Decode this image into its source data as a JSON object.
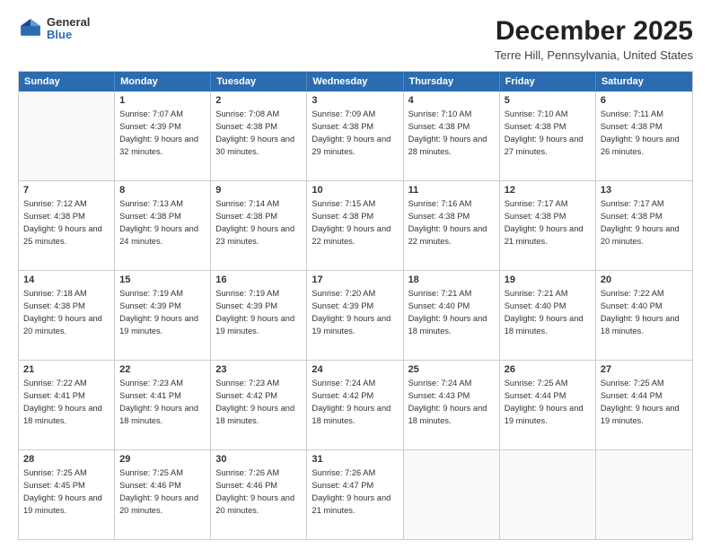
{
  "header": {
    "logo_general": "General",
    "logo_blue": "Blue",
    "title": "December 2025",
    "subtitle": "Terre Hill, Pennsylvania, United States"
  },
  "days_of_week": [
    "Sunday",
    "Monday",
    "Tuesday",
    "Wednesday",
    "Thursday",
    "Friday",
    "Saturday"
  ],
  "weeks": [
    [
      {
        "day": "",
        "empty": true
      },
      {
        "day": "1",
        "sunrise": "Sunrise: 7:07 AM",
        "sunset": "Sunset: 4:39 PM",
        "daylight": "Daylight: 9 hours and 32 minutes."
      },
      {
        "day": "2",
        "sunrise": "Sunrise: 7:08 AM",
        "sunset": "Sunset: 4:38 PM",
        "daylight": "Daylight: 9 hours and 30 minutes."
      },
      {
        "day": "3",
        "sunrise": "Sunrise: 7:09 AM",
        "sunset": "Sunset: 4:38 PM",
        "daylight": "Daylight: 9 hours and 29 minutes."
      },
      {
        "day": "4",
        "sunrise": "Sunrise: 7:10 AM",
        "sunset": "Sunset: 4:38 PM",
        "daylight": "Daylight: 9 hours and 28 minutes."
      },
      {
        "day": "5",
        "sunrise": "Sunrise: 7:10 AM",
        "sunset": "Sunset: 4:38 PM",
        "daylight": "Daylight: 9 hours and 27 minutes."
      },
      {
        "day": "6",
        "sunrise": "Sunrise: 7:11 AM",
        "sunset": "Sunset: 4:38 PM",
        "daylight": "Daylight: 9 hours and 26 minutes."
      }
    ],
    [
      {
        "day": "7",
        "sunrise": "Sunrise: 7:12 AM",
        "sunset": "Sunset: 4:38 PM",
        "daylight": "Daylight: 9 hours and 25 minutes."
      },
      {
        "day": "8",
        "sunrise": "Sunrise: 7:13 AM",
        "sunset": "Sunset: 4:38 PM",
        "daylight": "Daylight: 9 hours and 24 minutes."
      },
      {
        "day": "9",
        "sunrise": "Sunrise: 7:14 AM",
        "sunset": "Sunset: 4:38 PM",
        "daylight": "Daylight: 9 hours and 23 minutes."
      },
      {
        "day": "10",
        "sunrise": "Sunrise: 7:15 AM",
        "sunset": "Sunset: 4:38 PM",
        "daylight": "Daylight: 9 hours and 22 minutes."
      },
      {
        "day": "11",
        "sunrise": "Sunrise: 7:16 AM",
        "sunset": "Sunset: 4:38 PM",
        "daylight": "Daylight: 9 hours and 22 minutes."
      },
      {
        "day": "12",
        "sunrise": "Sunrise: 7:17 AM",
        "sunset": "Sunset: 4:38 PM",
        "daylight": "Daylight: 9 hours and 21 minutes."
      },
      {
        "day": "13",
        "sunrise": "Sunrise: 7:17 AM",
        "sunset": "Sunset: 4:38 PM",
        "daylight": "Daylight: 9 hours and 20 minutes."
      }
    ],
    [
      {
        "day": "14",
        "sunrise": "Sunrise: 7:18 AM",
        "sunset": "Sunset: 4:38 PM",
        "daylight": "Daylight: 9 hours and 20 minutes."
      },
      {
        "day": "15",
        "sunrise": "Sunrise: 7:19 AM",
        "sunset": "Sunset: 4:39 PM",
        "daylight": "Daylight: 9 hours and 19 minutes."
      },
      {
        "day": "16",
        "sunrise": "Sunrise: 7:19 AM",
        "sunset": "Sunset: 4:39 PM",
        "daylight": "Daylight: 9 hours and 19 minutes."
      },
      {
        "day": "17",
        "sunrise": "Sunrise: 7:20 AM",
        "sunset": "Sunset: 4:39 PM",
        "daylight": "Daylight: 9 hours and 19 minutes."
      },
      {
        "day": "18",
        "sunrise": "Sunrise: 7:21 AM",
        "sunset": "Sunset: 4:40 PM",
        "daylight": "Daylight: 9 hours and 18 minutes."
      },
      {
        "day": "19",
        "sunrise": "Sunrise: 7:21 AM",
        "sunset": "Sunset: 4:40 PM",
        "daylight": "Daylight: 9 hours and 18 minutes."
      },
      {
        "day": "20",
        "sunrise": "Sunrise: 7:22 AM",
        "sunset": "Sunset: 4:40 PM",
        "daylight": "Daylight: 9 hours and 18 minutes."
      }
    ],
    [
      {
        "day": "21",
        "sunrise": "Sunrise: 7:22 AM",
        "sunset": "Sunset: 4:41 PM",
        "daylight": "Daylight: 9 hours and 18 minutes."
      },
      {
        "day": "22",
        "sunrise": "Sunrise: 7:23 AM",
        "sunset": "Sunset: 4:41 PM",
        "daylight": "Daylight: 9 hours and 18 minutes."
      },
      {
        "day": "23",
        "sunrise": "Sunrise: 7:23 AM",
        "sunset": "Sunset: 4:42 PM",
        "daylight": "Daylight: 9 hours and 18 minutes."
      },
      {
        "day": "24",
        "sunrise": "Sunrise: 7:24 AM",
        "sunset": "Sunset: 4:42 PM",
        "daylight": "Daylight: 9 hours and 18 minutes."
      },
      {
        "day": "25",
        "sunrise": "Sunrise: 7:24 AM",
        "sunset": "Sunset: 4:43 PM",
        "daylight": "Daylight: 9 hours and 18 minutes."
      },
      {
        "day": "26",
        "sunrise": "Sunrise: 7:25 AM",
        "sunset": "Sunset: 4:44 PM",
        "daylight": "Daylight: 9 hours and 19 minutes."
      },
      {
        "day": "27",
        "sunrise": "Sunrise: 7:25 AM",
        "sunset": "Sunset: 4:44 PM",
        "daylight": "Daylight: 9 hours and 19 minutes."
      }
    ],
    [
      {
        "day": "28",
        "sunrise": "Sunrise: 7:25 AM",
        "sunset": "Sunset: 4:45 PM",
        "daylight": "Daylight: 9 hours and 19 minutes."
      },
      {
        "day": "29",
        "sunrise": "Sunrise: 7:25 AM",
        "sunset": "Sunset: 4:46 PM",
        "daylight": "Daylight: 9 hours and 20 minutes."
      },
      {
        "day": "30",
        "sunrise": "Sunrise: 7:26 AM",
        "sunset": "Sunset: 4:46 PM",
        "daylight": "Daylight: 9 hours and 20 minutes."
      },
      {
        "day": "31",
        "sunrise": "Sunrise: 7:26 AM",
        "sunset": "Sunset: 4:47 PM",
        "daylight": "Daylight: 9 hours and 21 minutes."
      },
      {
        "day": "",
        "empty": true
      },
      {
        "day": "",
        "empty": true
      },
      {
        "day": "",
        "empty": true
      }
    ]
  ]
}
